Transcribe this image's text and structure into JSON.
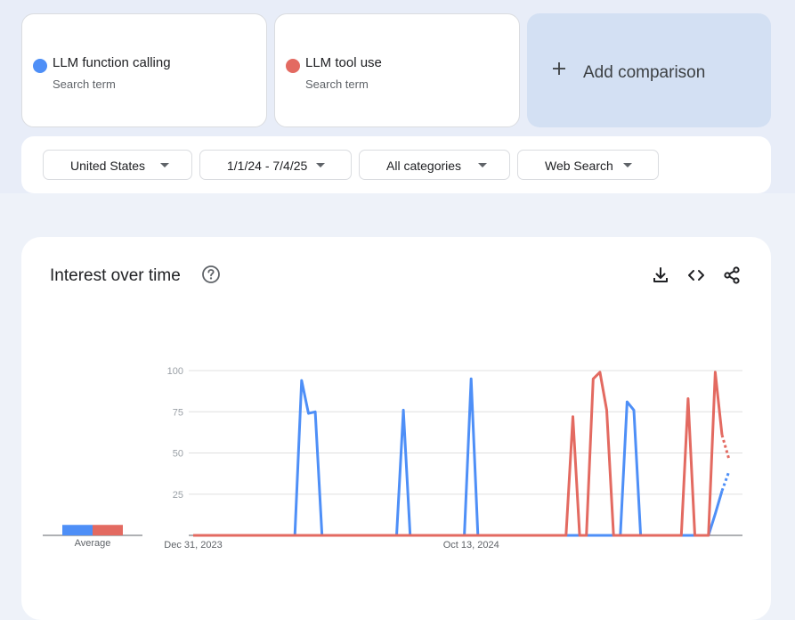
{
  "terms": [
    {
      "name": "LLM function calling",
      "subtitle": "Search term",
      "color": "#4e8ff7"
    },
    {
      "name": "LLM tool use",
      "subtitle": "Search term",
      "color": "#e36a61"
    }
  ],
  "add_comparison": {
    "label": "Add comparison",
    "icon": "plus-icon"
  },
  "filters": {
    "region": "United States",
    "date_range": "1/1/24 - 7/4/25",
    "category": "All categories",
    "search_type": "Web Search"
  },
  "chart_panel": {
    "title": "Interest over time",
    "icons": [
      "help-icon",
      "download-icon",
      "embed-code-icon",
      "share-icon"
    ]
  },
  "average": {
    "label": "Average",
    "values": [
      7,
      7
    ]
  },
  "chart_data": {
    "type": "line",
    "title": "Interest over time",
    "ylim": [
      0,
      100
    ],
    "yticks": [
      25,
      50,
      75,
      100
    ],
    "x_tick_labels": [
      "Dec 31, 2023",
      "Oct 13, 2024"
    ],
    "x": [
      "2023-12-31",
      "2024-01-07",
      "2024-01-14",
      "2024-01-21",
      "2024-01-28",
      "2024-02-04",
      "2024-02-11",
      "2024-02-18",
      "2024-02-25",
      "2024-03-03",
      "2024-03-10",
      "2024-03-17",
      "2024-03-24",
      "2024-03-31",
      "2024-04-07",
      "2024-04-14",
      "2024-04-21",
      "2024-04-28",
      "2024-05-05",
      "2024-05-12",
      "2024-05-19",
      "2024-05-26",
      "2024-06-02",
      "2024-06-09",
      "2024-06-16",
      "2024-06-23",
      "2024-06-30",
      "2024-07-07",
      "2024-07-14",
      "2024-07-21",
      "2024-07-28",
      "2024-08-04",
      "2024-08-11",
      "2024-08-18",
      "2024-08-25",
      "2024-09-01",
      "2024-09-08",
      "2024-09-15",
      "2024-09-22",
      "2024-09-29",
      "2024-10-06",
      "2024-10-13",
      "2024-10-20",
      "2024-10-27",
      "2024-11-03",
      "2024-11-10",
      "2024-11-17",
      "2024-11-24",
      "2024-12-01",
      "2024-12-08",
      "2024-12-15",
      "2024-12-22",
      "2024-12-29",
      "2025-01-05",
      "2025-01-12",
      "2025-01-19",
      "2025-01-26",
      "2025-02-02",
      "2025-02-09",
      "2025-02-16",
      "2025-02-23",
      "2025-03-02",
      "2025-03-09",
      "2025-03-16",
      "2025-03-23",
      "2025-03-30",
      "2025-04-06",
      "2025-04-13",
      "2025-04-20",
      "2025-04-27",
      "2025-05-04",
      "2025-05-11",
      "2025-05-18",
      "2025-05-25",
      "2025-06-01",
      "2025-06-08",
      "2025-06-15",
      "2025-06-22",
      "2025-06-29"
    ],
    "series": [
      {
        "name": "LLM function calling",
        "color": "#4e8ff7",
        "values": [
          0,
          0,
          0,
          0,
          0,
          0,
          0,
          0,
          0,
          0,
          0,
          0,
          0,
          0,
          0,
          0,
          94,
          74,
          75,
          0,
          0,
          0,
          0,
          0,
          0,
          0,
          0,
          0,
          0,
          0,
          0,
          76,
          0,
          0,
          0,
          0,
          0,
          0,
          0,
          0,
          0,
          95,
          0,
          0,
          0,
          0,
          0,
          0,
          0,
          0,
          0,
          0,
          0,
          0,
          0,
          0,
          0,
          0,
          0,
          0,
          0,
          0,
          0,
          0,
          81,
          76,
          0,
          0,
          0,
          0,
          0,
          0,
          0,
          0,
          0,
          0,
          0,
          13,
          27
        ],
        "partial_last_values": [
          27,
          39
        ]
      },
      {
        "name": "LLM tool use",
        "color": "#e36a61",
        "values": [
          0,
          0,
          0,
          0,
          0,
          0,
          0,
          0,
          0,
          0,
          0,
          0,
          0,
          0,
          0,
          0,
          0,
          0,
          0,
          0,
          0,
          0,
          0,
          0,
          0,
          0,
          0,
          0,
          0,
          0,
          0,
          0,
          0,
          0,
          0,
          0,
          0,
          0,
          0,
          0,
          0,
          0,
          0,
          0,
          0,
          0,
          0,
          0,
          0,
          0,
          0,
          0,
          0,
          0,
          0,
          0,
          72,
          0,
          0,
          95,
          99,
          76,
          0,
          0,
          0,
          0,
          0,
          0,
          0,
          0,
          0,
          0,
          0,
          83,
          0,
          0,
          0,
          99,
          61
        ],
        "partial_last_values": [
          61,
          46
        ]
      }
    ]
  }
}
